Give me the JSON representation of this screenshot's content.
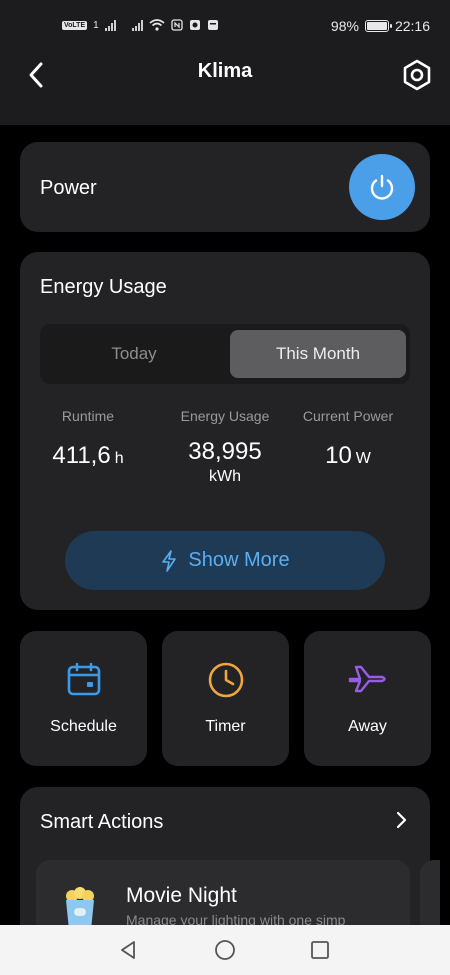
{
  "status_bar": {
    "network_badge": "VoLTE",
    "sim_indicator": "1",
    "battery_percent": "98%",
    "battery_level": 0.98,
    "time": "22:16"
  },
  "app_bar": {
    "title": "Klima",
    "back_icon": "chevron-left-icon",
    "settings_icon": "hexagon-settings-icon"
  },
  "power": {
    "label": "Power",
    "icon": "power-icon",
    "accent_color": "#4a9fe8"
  },
  "energy": {
    "title": "Energy Usage",
    "tabs": [
      {
        "label": "Today",
        "selected": false
      },
      {
        "label": "This Month",
        "selected": true
      }
    ],
    "stats": [
      {
        "label": "Runtime",
        "value": "411,6",
        "unit": "h"
      },
      {
        "label": "Energy Usage",
        "value": "38,995",
        "unit": "kWh"
      },
      {
        "label": "Current Power",
        "value": "10",
        "unit": "W"
      }
    ],
    "show_more": {
      "label": "Show More",
      "icon": "lightning-icon"
    }
  },
  "tiles": [
    {
      "label": "Schedule",
      "icon": "calendar-icon",
      "color": "#3b9be8"
    },
    {
      "label": "Timer",
      "icon": "clock-icon",
      "color": "#f0a540"
    },
    {
      "label": "Away",
      "icon": "airplane-icon",
      "color": "#9a5be8"
    }
  ],
  "smart_actions": {
    "title": "Smart Actions",
    "items": [
      {
        "title": "Movie Night",
        "description": "Manage your lighting with one simp",
        "icon": "popcorn-icon"
      }
    ]
  },
  "nav_bar": {
    "back_icon": "triangle-back-icon",
    "home_icon": "circle-home-icon",
    "recents_icon": "square-recents-icon"
  }
}
